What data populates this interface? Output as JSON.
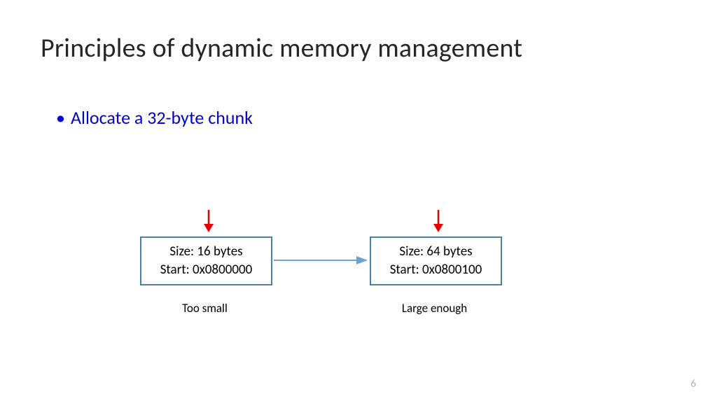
{
  "title": "Principles of dynamic memory management",
  "bullet": "Allocate a 32-byte chunk",
  "nodes": {
    "left": {
      "line1": "Size: 16 bytes",
      "line2": "Start: 0x0800000",
      "caption": "Too small"
    },
    "right": {
      "line1": "Size: 64 bytes",
      "line2": "Start: 0x0800100",
      "caption": "Large enough"
    }
  },
  "page_number": "6",
  "colors": {
    "accent_blue": "#0000cc",
    "box_border": "#4a7fa8",
    "link_arrow": "#6ea3d1",
    "red_arrow": "#e60000"
  }
}
